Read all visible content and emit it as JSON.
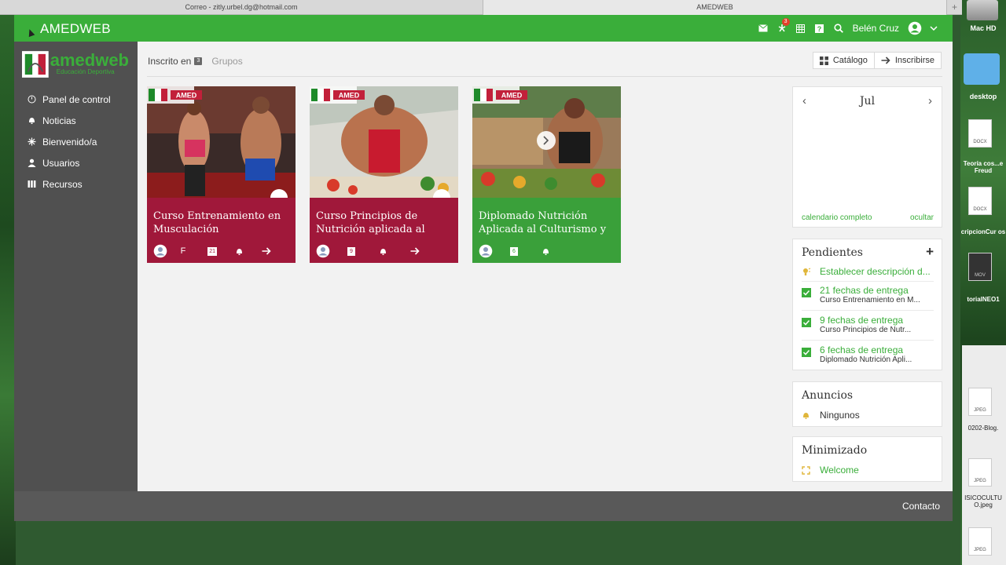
{
  "browser": {
    "tabs": [
      {
        "label": "Correo - zitly.urbel.dg@hotmail.com",
        "active": false
      },
      {
        "label": "AMEDWEB",
        "active": true
      }
    ],
    "new_tab": "+"
  },
  "navbar": {
    "brand": "AMEDWEB",
    "notification_count": "3",
    "user_name": "Belén Cruz",
    "icons": [
      "mail-icon",
      "notifications-icon",
      "calendar-icon",
      "help-icon",
      "search-icon",
      "user-avatar-icon",
      "chevron-down-icon"
    ],
    "color": "#3aae3a"
  },
  "logo": {
    "name": "amedweb",
    "tagline": "Educación Deportiva"
  },
  "sidebar": {
    "items": [
      {
        "label": "Panel de control",
        "icon": "dashboard-icon"
      },
      {
        "label": "Noticias",
        "icon": "bell-icon"
      },
      {
        "label": "Bienvenido/a",
        "icon": "sparkle-icon"
      },
      {
        "label": "Usuarios",
        "icon": "user-icon"
      },
      {
        "label": "Recursos",
        "icon": "library-icon"
      }
    ]
  },
  "main": {
    "tab_enrolled": "Inscrito en",
    "tab_enrolled_count": "3",
    "tab_groups": "Grupos",
    "catalog_btn": "Catálogo",
    "enroll_btn": "Inscribirse"
  },
  "courses": [
    {
      "title": "Curso Entrenamiento en Musculación",
      "color": "#a0183a",
      "icon_text_1": "F",
      "icon_text_2": "21",
      "image_logo": "AMED"
    },
    {
      "title": "Curso Principios de Nutrición aplicada al",
      "color": "#a0183a",
      "icon_text_2": "9",
      "image_logo": "AMED"
    },
    {
      "title": "Diplomado Nutrición Aplicada al Culturismo y",
      "color": "#3aa03a",
      "icon_text_2": "6",
      "image_logo": "AMED"
    }
  ],
  "calendar": {
    "month": "Jul",
    "full_link": "calendario completo",
    "hide_link": "ocultar"
  },
  "pending": {
    "title": "Pendientes",
    "add": "+",
    "items": [
      {
        "text": "Establecer descripción d...",
        "sub": "",
        "icon": "lightbulb-icon"
      },
      {
        "text": "21 fechas de entrega",
        "sub": "Curso Entrenamiento en M...",
        "icon": "checkbox-icon"
      },
      {
        "text": "9 fechas de entrega",
        "sub": "Curso Principios de Nutr...",
        "icon": "checkbox-icon"
      },
      {
        "text": "6 fechas de entrega",
        "sub": "Diplomado Nutrición Apli...",
        "icon": "checkbox-icon"
      }
    ]
  },
  "announcements": {
    "title": "Anuncios",
    "item": "Ningunos"
  },
  "minimized": {
    "title": "Minimizado",
    "item": "Welcome"
  },
  "footer": {
    "contact": "Contacto"
  },
  "desktop": {
    "hd_label": "Mac HD",
    "folder_label": "desktop",
    "files": [
      {
        "label": "Teoría\n cos...e Freud",
        "type": "DOCX"
      },
      {
        "label": "cripcionCur os",
        "type": "DOCX"
      },
      {
        "label": "torialNEO1",
        "type": "MOV"
      },
      {
        "label": "0202-Blog.",
        "type": "JPEG"
      },
      {
        "label": "ISICOCULTU O.jpeg",
        "type": "JPEG"
      },
      {
        "label": "",
        "type": "JPEG"
      }
    ]
  }
}
